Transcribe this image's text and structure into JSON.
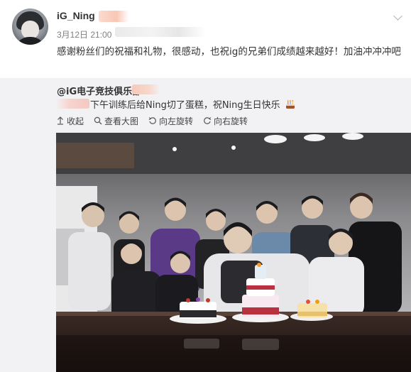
{
  "post": {
    "username": "iG_Ning",
    "time": "3月12日 21:00",
    "text": "感谢粉丝们的祝福和礼物，很感动，也祝ig的兄弟们成绩越来越好！加油冲冲冲吧"
  },
  "repost": {
    "author": "@iG电子竞技俱乐部",
    "text": "下午训练后给Ning切了蛋糕，祝Ning生日快乐",
    "emoji": "cake-icon"
  },
  "toolbar": {
    "collapse": "收起",
    "view_large": "查看大图",
    "rotate_left": "向左旋转",
    "rotate_right": "向右旋转"
  },
  "colors": {
    "repost_bg": "#f2f2f5",
    "text": "#333333",
    "muted": "#808080"
  }
}
